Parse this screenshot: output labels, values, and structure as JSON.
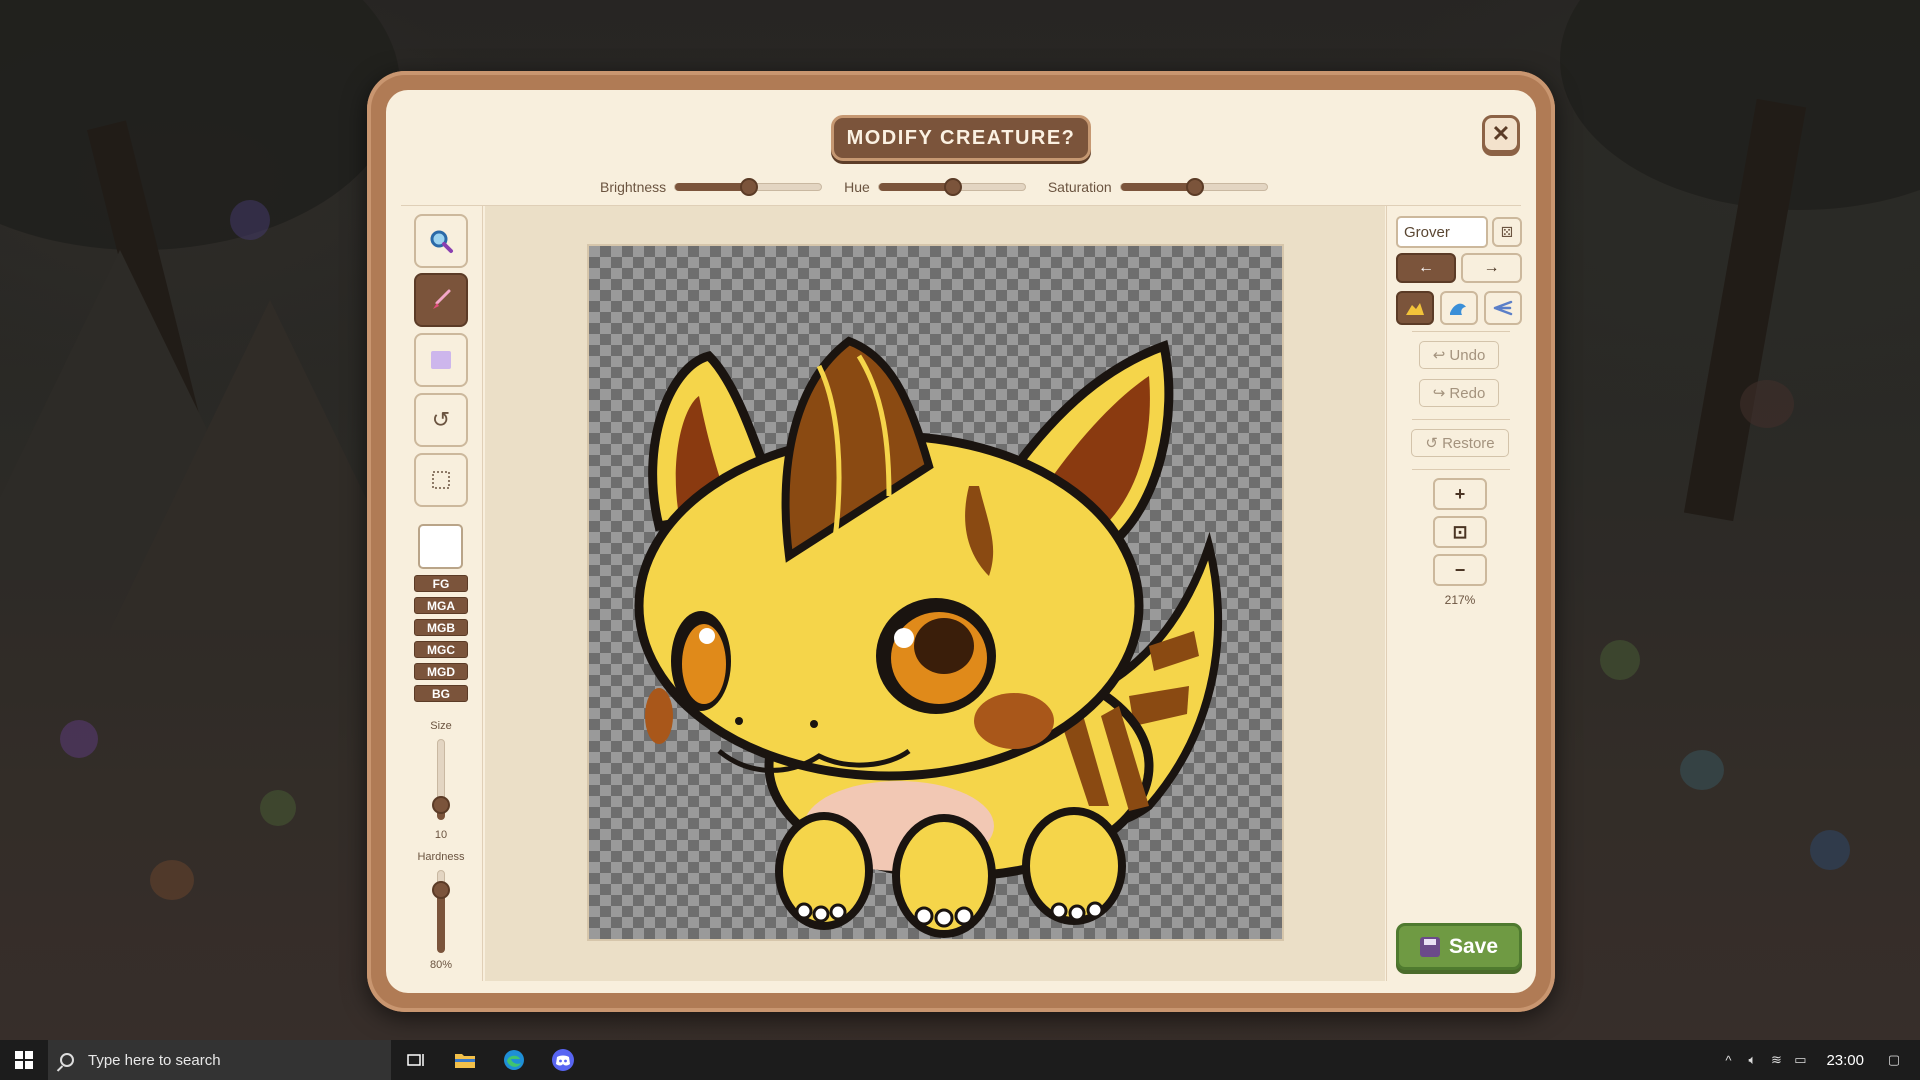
{
  "dialog": {
    "title": "MODIFY CREATURE?",
    "close_icon": "close-icon"
  },
  "adjustments": {
    "brightness_label": "Brightness",
    "brightness_level": 0.5,
    "hue_label": "Hue",
    "hue_level": 0.5,
    "saturation_label": "Saturation",
    "saturation_level": 0.5
  },
  "tools": {
    "items": [
      "zoom-tool",
      "brush-tool",
      "eraser-tool",
      "rotate-tool",
      "select-tool"
    ],
    "active": "brush-tool",
    "layers": [
      "FG",
      "MGA",
      "MGB",
      "MGC",
      "MGD",
      "BG"
    ],
    "size_label": "Size",
    "size_value": "10",
    "hardness_label": "Hardness",
    "hardness_value": "80%"
  },
  "right_panel": {
    "name_value": "Grover",
    "undo_label": "↩ Undo",
    "redo_label": "↪ Redo",
    "restore_label": "↺ Restore",
    "zoom_in": "+",
    "zoom_fit": "⊡",
    "zoom_out": "−",
    "zoom_percent": "217%",
    "save_label": "Save",
    "arrow_left": "←",
    "arrow_right": "→"
  },
  "taskbar": {
    "search_placeholder": "Type here to search",
    "time": "23:00"
  },
  "colors": {
    "accent": "#7b543b",
    "save": "#6f9a43",
    "creature_body": "#f5d54a",
    "creature_stripe": "#8a4a12"
  }
}
